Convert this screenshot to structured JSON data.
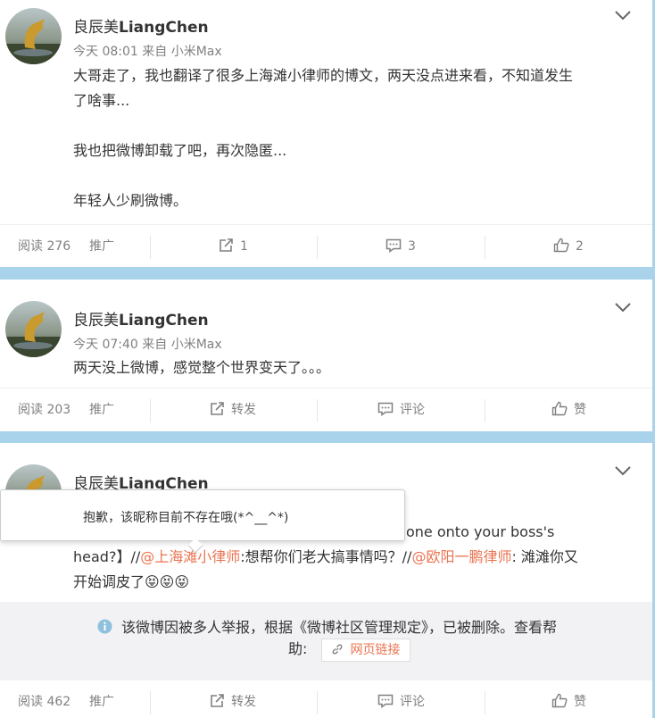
{
  "colors": {
    "background": "#a9d3ea",
    "card": "#ffffff",
    "link": "#eb7350",
    "meta": "#808080"
  },
  "posts": [
    {
      "user": {
        "name_cn": "良辰美",
        "name_en": "LiangChen"
      },
      "meta": "今天 08:01 来自 小米Max",
      "lines": [
        "大哥走了，我也翻译了很多上海滩小律师的博文，两天没点进来看，不知道发生",
        "了啥事...",
        "我也把微博卸载了吧，再次隐匿...",
        "年轻人少刷微博。"
      ],
      "actions": {
        "reads": "阅读 276",
        "promote": "推广",
        "repost": "1",
        "comment": "3",
        "like": "2"
      }
    },
    {
      "user": {
        "name_cn": "良辰美",
        "name_en": "LiangChen"
      },
      "meta": "今天 07:40 来自 小米Max",
      "lines": [
        "两天没上微博，感觉整个世界变天了。。。"
      ],
      "actions": {
        "reads": "阅读 203",
        "promote": "推广",
        "repost": "转发",
        "comment": "评论",
        "like": "赞"
      }
    },
    {
      "user": {
        "name_cn": "良辰美",
        "name_en": "LiangChen"
      },
      "partial_text": "one onto your boss's",
      "line2": {
        "a": "head?】//",
        "mention1": "@上海滩小律师",
        "b": ":想帮你们老大搞事情吗？//",
        "mention2": "@欧阳一鹏律师",
        "c": ":  滩滩你又"
      },
      "line3": "开始调皮了😝😝😝",
      "notice": "该微博因被多人举报，根据《微博社区管理规定》，已被删除。查看帮",
      "notice2": "助:",
      "weblink": "网页链接",
      "actions": {
        "reads": "阅读 462",
        "promote": "推广",
        "repost": "转发",
        "comment": "评论",
        "like": "赞"
      }
    }
  ],
  "tooltip": {
    "text": "抱歉，该昵称目前不存在哦(*^__^*)"
  }
}
